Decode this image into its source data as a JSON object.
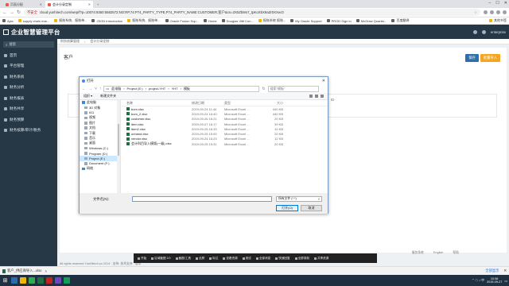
{
  "browser": {
    "tabs": [
      {
        "label": "页面分配"
      },
      {
        "label": "会计分录定制"
      }
    ],
    "not_secure": "不安全",
    "url": "cloud.yunhitech.com/wep/f?p=10074:9350:5582572:NO:RP,74:P74_PARTY_TYPE,P74_PARTY_NAME:CUSTOMER,客户&cs=3X0Zb9m7_tpKoXbX9aZr0XXec0",
    "bookmarks": [
      "Ajax",
      "supply chain mar...",
      "报账系统、报账单...",
      "JSON Introduction",
      "报账系统、报账单...",
      "Oracle Fusion Sup...",
      "Home",
      "Douglas Vitti Con...",
      "报账系统 报账...",
      "My Oracle Support",
      "PROD Sign In",
      "McGraw Quarter...",
      "百度翻译"
    ],
    "other_bookmarks": "其他书签"
  },
  "app": {
    "title": "企业智慧管理平台",
    "user": "enterprise"
  },
  "sidebar": {
    "search_placeholder": "搜索",
    "items": [
      {
        "label": "首页"
      },
      {
        "label": "平台管理"
      },
      {
        "label": "财务系统"
      },
      {
        "label": "财务分析"
      },
      {
        "label": "财务报表"
      },
      {
        "label": "财务共享"
      },
      {
        "label": "财务预算"
      },
      {
        "label": "财务核算/审计/税务"
      }
    ]
  },
  "main": {
    "breadcrumb": [
      "财务核算管理",
      "会计分录定制"
    ],
    "page_title": "客户",
    "btn_save": "保存",
    "btn_action": "批量导入",
    "table_headers": [
      "名称",
      "编码",
      "ID"
    ],
    "footer_links": [
      "服务条款",
      "English",
      "帮助"
    ],
    "copyright": "All rights reserved YunHitech.co 2014 · 支持: 技术支持 · 版本"
  },
  "dialog": {
    "title": "打开",
    "close": "✕",
    "breadcrumbs": [
      "此电脑",
      "Project (E:)",
      "project-YHT",
      "YHT",
      "模板"
    ],
    "search_placeholder": "搜索\"模板\"",
    "organize": "组织 ▾",
    "new_folder": "新建文件夹",
    "tree": [
      {
        "label": "此电脑",
        "top": true
      },
      {
        "label": "3D 对象"
      },
      {
        "label": "611"
      },
      {
        "label": "视频"
      },
      {
        "label": "图片"
      },
      {
        "label": "文档"
      },
      {
        "label": "下载"
      },
      {
        "label": "音乐"
      },
      {
        "label": "桌面"
      },
      {
        "label": "Windows (C:)"
      },
      {
        "label": "Program (D:)"
      },
      {
        "label": "Project (E:)",
        "selected": true
      },
      {
        "label": "Document (F:)"
      },
      {
        "label": "网络",
        "top": true
      }
    ],
    "file_headers": [
      "名称",
      "修改日期",
      "类型",
      "大小"
    ],
    "files": [
      {
        "name": "bom.xlsx",
        "date": "2019-09-24 11:44",
        "type": "Microsoft Excel ...",
        "size": "440 KB"
      },
      {
        "name": "bom_2.xlsx",
        "date": "2019-09-24 16:40",
        "type": "Microsoft Excel ...",
        "size": "440 KB"
      },
      {
        "name": "customer.xlsx",
        "date": "2019-09-26 16:21",
        "type": "Microsoft Excel ...",
        "size": "20 KB"
      },
      {
        "name": "item.xlsx",
        "date": "2019-09-07 16:17",
        "type": "Microsoft Excel ...",
        "size": "39 KB"
      },
      {
        "name": "item2.xlsx",
        "date": "2019-09-25 16:33",
        "type": "Microsoft Excel ...",
        "size": "10 KB"
      },
      {
        "name": "onhand.xlsx",
        "date": "2019-09-25 15:00",
        "type": "Microsoft Excel ...",
        "size": "20 KB"
      },
      {
        "name": "vendor.xlsx",
        "date": "2019-09-24 16:23",
        "type": "Microsoft Excel ...",
        "size": "12 KB"
      },
      {
        "name": "会计科目导入模版(一级).xlsx",
        "date": "2019-09-25 19:31",
        "type": "Microsoft Excel ...",
        "size": "20 KB"
      }
    ],
    "filename_label": "文件名(N):",
    "filename_value": "",
    "filetype": "所有文件 (*.*)",
    "open": "打开(O)",
    "cancel": "取消"
  },
  "float_toolbar": [
    "开始",
    "区域截图 1/0",
    "截图/工具",
    "全屏",
    "标注",
    "查看资源",
    "测试",
    "全部消息",
    "快速回复",
    "全屏录制",
    "共享资源"
  ],
  "downloads": {
    "file": "客户_供应商导入...xlsx",
    "show_all": "全部显示"
  },
  "taskbar": {
    "time": "10:56",
    "date": "2019-09-27"
  }
}
